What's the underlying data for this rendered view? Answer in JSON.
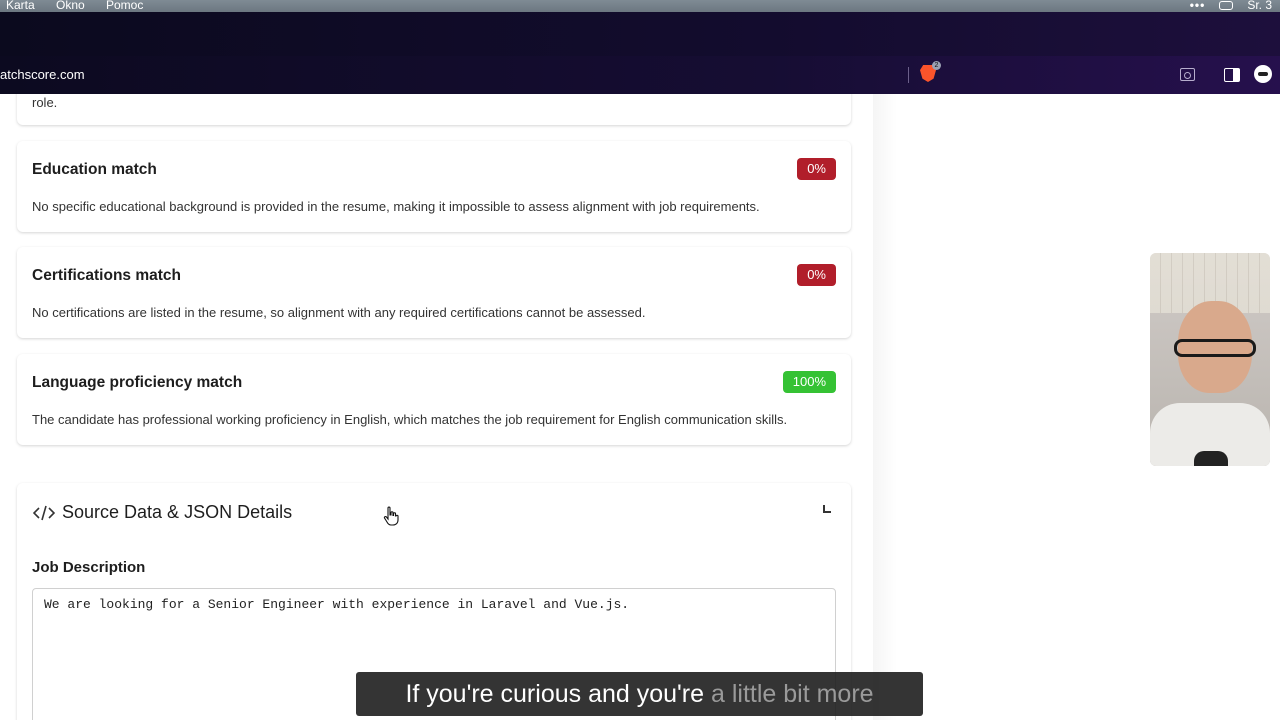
{
  "menubar": {
    "items": [
      "Karta",
      "Okno",
      "Pomoc"
    ],
    "dots": "•••",
    "clock": "Sr. 3"
  },
  "browser": {
    "url": "atchscore.com",
    "brave_badge": "2"
  },
  "top_card": {
    "text": "role."
  },
  "matches": [
    {
      "title": "Education match",
      "score": "0%",
      "status": "bad",
      "description": "No specific educational background is provided in the resume, making it impossible to assess alignment with job requirements."
    },
    {
      "title": "Certifications match",
      "score": "0%",
      "status": "bad",
      "description": "No certifications are listed in the resume, so alignment with any required certifications cannot be assessed."
    },
    {
      "title": "Language proficiency match",
      "score": "100%",
      "status": "good",
      "description": "The candidate has professional working proficiency in English, which matches the job requirement for English communication skills."
    }
  ],
  "source_section": {
    "title": "Source Data & JSON Details",
    "job_label": "Job Description",
    "job_text": "We are looking for a Senior Engineer with experience in Laravel and Vue.js."
  },
  "caption": {
    "main": "If you're curious and you're",
    "faded": "a little bit more"
  },
  "colors": {
    "badge_bad": "#b11e2a",
    "badge_good": "#35c234",
    "chrome_dark": "#0b0a1e",
    "chrome_purple": "#26104d"
  }
}
